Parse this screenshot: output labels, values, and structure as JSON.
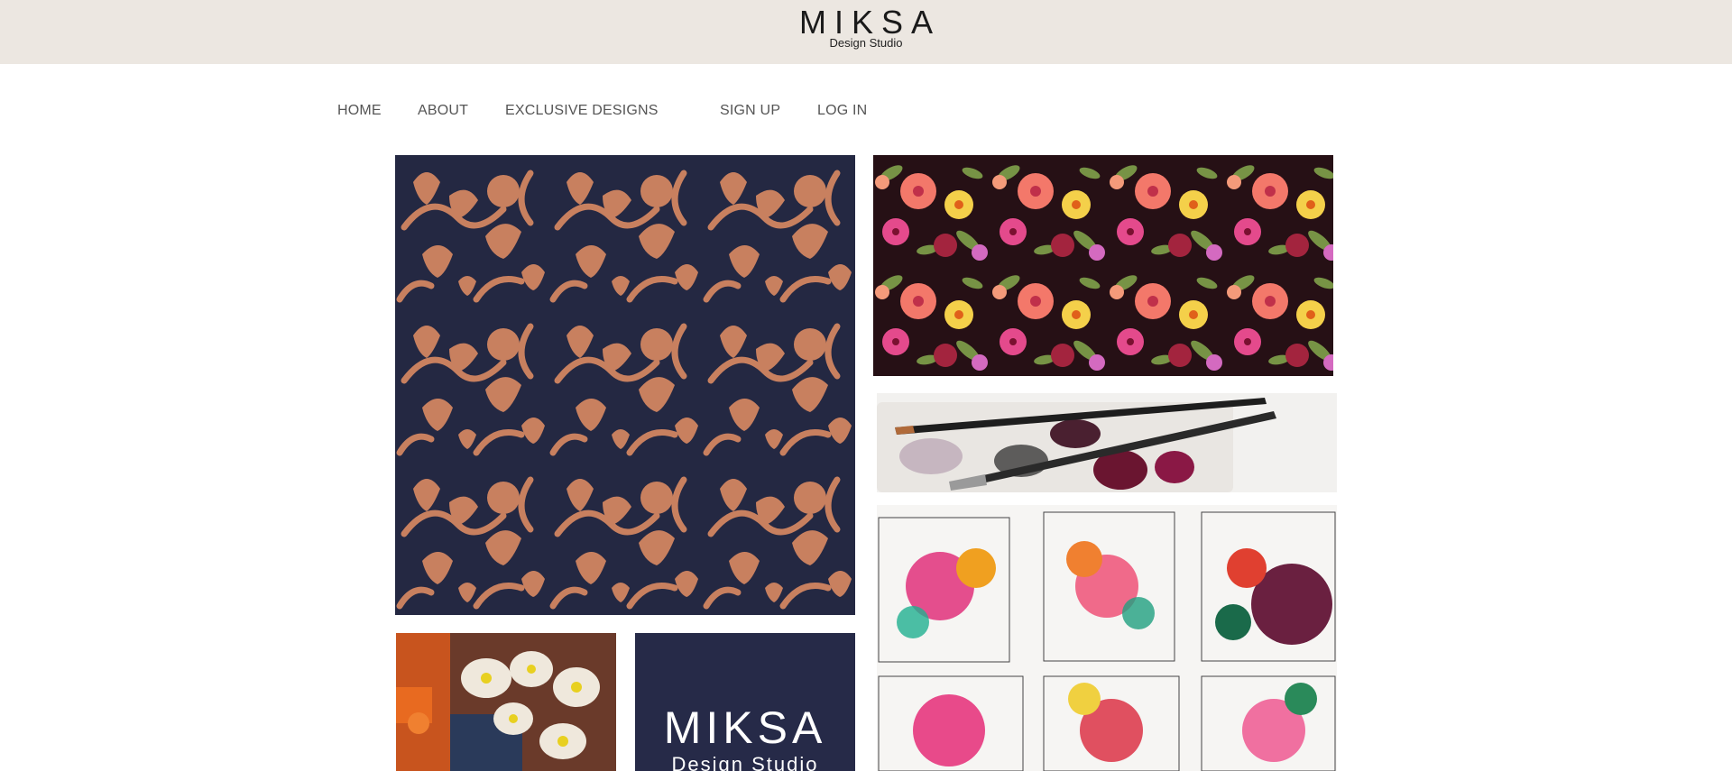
{
  "header": {
    "brand_title": "MIKSA",
    "brand_subtitle": "Design Studio",
    "background_color": "#ece7e1"
  },
  "nav": {
    "items": [
      {
        "label": "HOME"
      },
      {
        "label": "ABOUT"
      },
      {
        "label": "EXCLUSIVE DESIGNS"
      },
      {
        "label": "SIGN UP"
      },
      {
        "label": "LOG IN"
      }
    ]
  },
  "gallery": {
    "logo_tile": {
      "title": "MIKSA",
      "subtitle": "Design Studio",
      "background_color": "#262a48"
    },
    "colors": {
      "navy": "#242842",
      "copper": "#c8805f",
      "dark_floral_bg": "#261015"
    }
  }
}
